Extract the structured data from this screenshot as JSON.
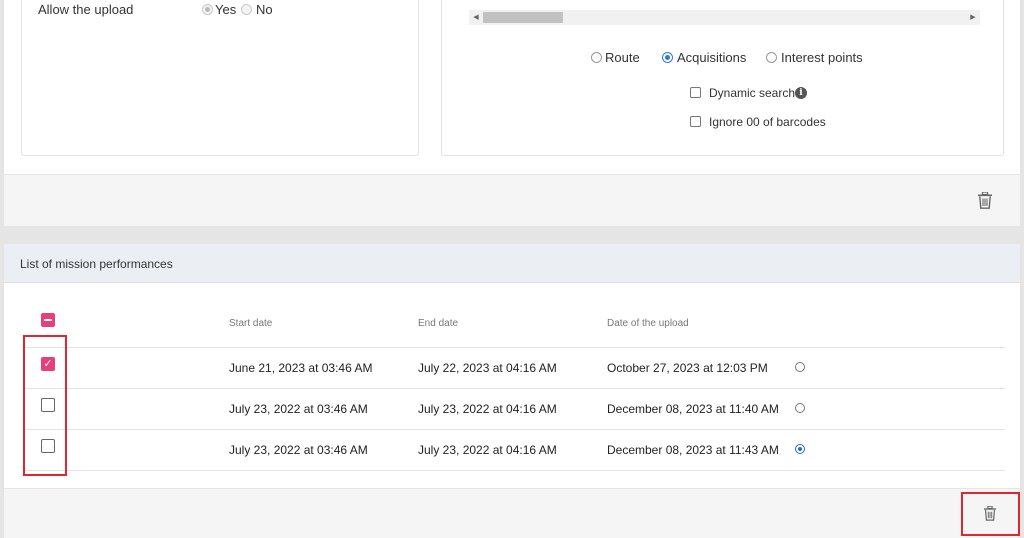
{
  "upload_setting": {
    "label": "Allow the upload",
    "yes": "Yes",
    "no": "No"
  },
  "scan_options": {
    "modes": [
      {
        "label": "Route",
        "checked": false
      },
      {
        "label": "Acquisitions",
        "checked": true
      },
      {
        "label": "Interest points",
        "checked": false
      }
    ],
    "dynamic_search": "Dynamic search",
    "ignore_barcodes": "Ignore 00 of barcodes"
  },
  "list": {
    "title": "List of mission performances",
    "columns": {
      "start": "Start date",
      "end": "End date",
      "upload": "Date of the upload"
    },
    "rows": [
      {
        "start": "June 21, 2023 at 03:46 AM",
        "end": "July 22, 2023 at 04:16 AM",
        "upload": "October 27, 2023 at 12:03 PM",
        "checked": true,
        "selected": false
      },
      {
        "start": "July 23, 2022 at 03:46 AM",
        "end": "July 23, 2022 at 04:16 AM",
        "upload": "December 08, 2023 at 11:40 AM",
        "checked": false,
        "selected": false
      },
      {
        "start": "July 23, 2022 at 03:46 AM",
        "end": "July 23, 2022 at 04:16 AM",
        "upload": "December 08, 2023 at 11:43 AM",
        "checked": false,
        "selected": true
      }
    ]
  },
  "icons": {
    "trash": "trash-icon",
    "info": "info-icon",
    "check": "check-icon"
  },
  "colors": {
    "accent_pink": "#e83e7b",
    "radio_blue": "#1e6fd9",
    "highlight_red": "#e0262e"
  }
}
